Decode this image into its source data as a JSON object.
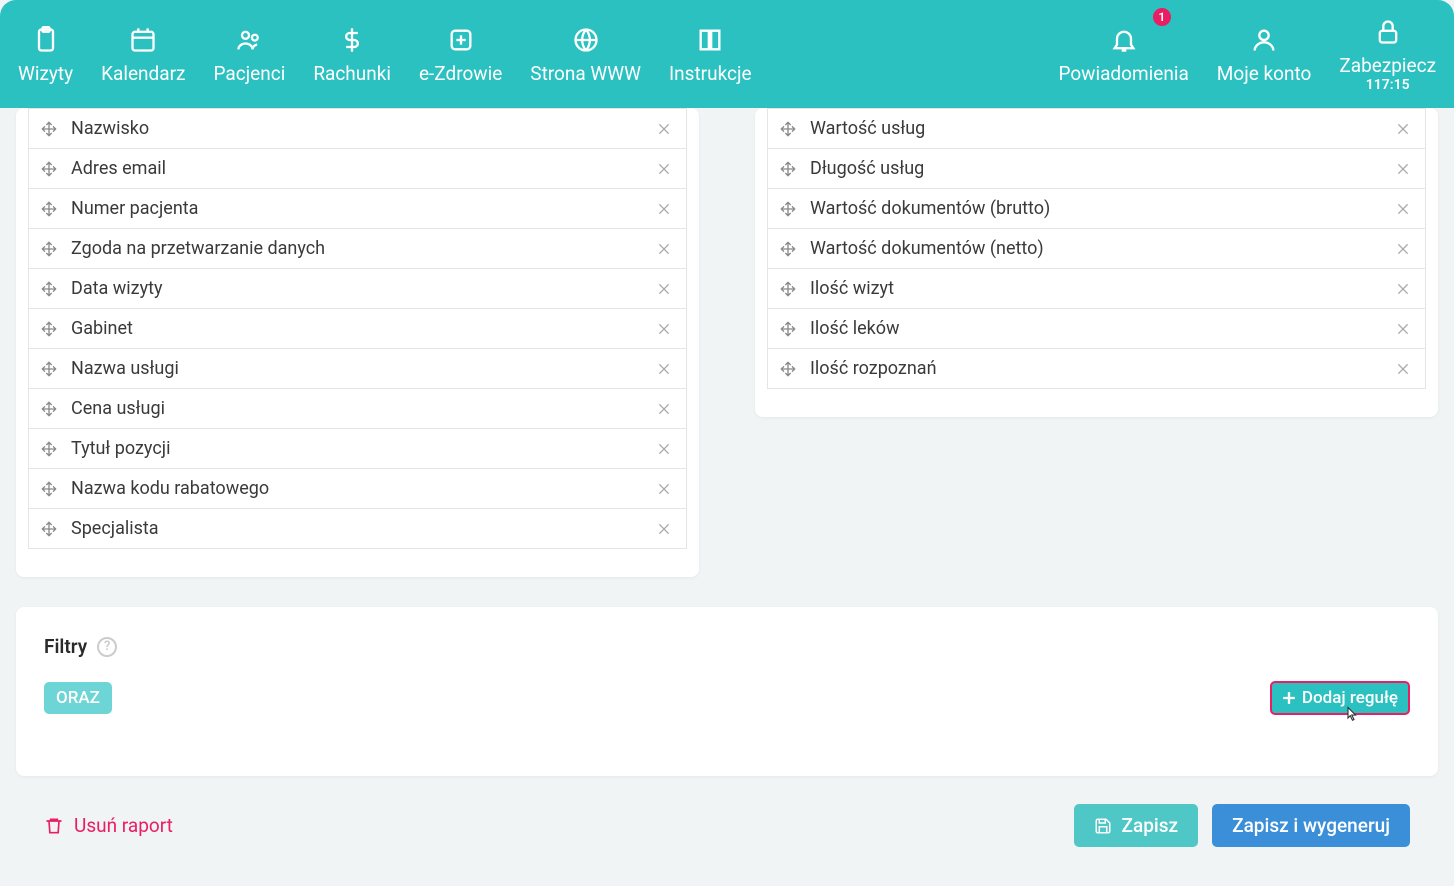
{
  "nav": {
    "items": [
      {
        "label": "Wizyty",
        "icon": "clipboard"
      },
      {
        "label": "Kalendarz",
        "icon": "calendar"
      },
      {
        "label": "Pacjenci",
        "icon": "users"
      },
      {
        "label": "Rachunki",
        "icon": "dollar"
      },
      {
        "label": "e-Zdrowie",
        "icon": "health"
      },
      {
        "label": "Strona WWW",
        "icon": "globe"
      },
      {
        "label": "Instrukcje",
        "icon": "book"
      }
    ],
    "right_items": [
      {
        "label": "Powiadomienia",
        "icon": "bell",
        "badge": "1"
      },
      {
        "label": "Moje konto",
        "icon": "user"
      },
      {
        "label": "Zabezpiecz",
        "icon": "lock",
        "timer": "117:15"
      }
    ]
  },
  "left_list": [
    "Nazwisko",
    "Adres email",
    "Numer pacjenta",
    "Zgoda na przetwarzanie danych",
    "Data wizyty",
    "Gabinet",
    "Nazwa usługi",
    "Cena usługi",
    "Tytuł pozycji",
    "Nazwa kodu rabatowego",
    "Specjalista"
  ],
  "right_list": [
    "Wartość usług",
    "Długość usług",
    "Wartość dokumentów (brutto)",
    "Wartość dokumentów (netto)",
    "Ilość wizyt",
    "Ilość leków",
    "Ilość rozpoznań"
  ],
  "filters": {
    "title": "Filtry",
    "oraz": "ORAZ",
    "add_rule": "Dodaj regułę"
  },
  "actions": {
    "delete": "Usuń raport",
    "save": "Zapisz",
    "generate": "Zapisz i wygeneruj"
  }
}
